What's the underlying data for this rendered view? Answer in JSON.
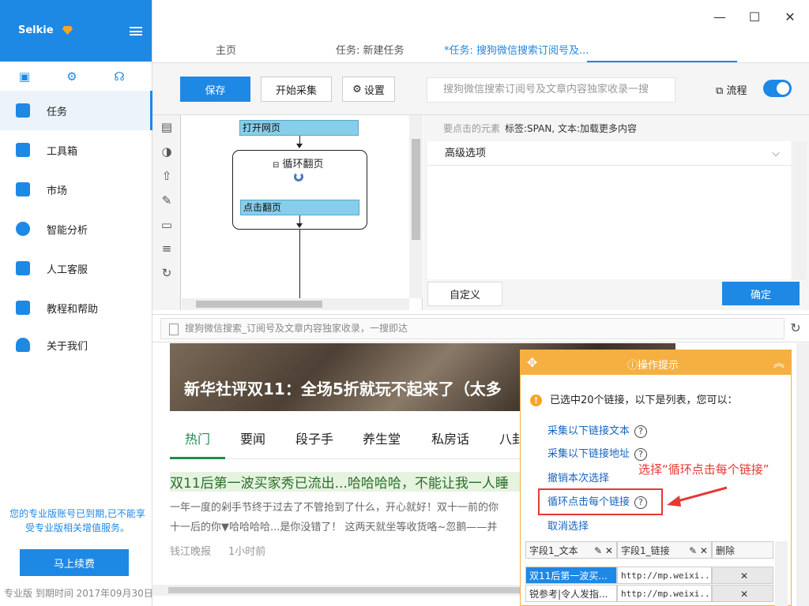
{
  "app": {
    "name": "Selkie"
  },
  "sidebar": {
    "items": [
      {
        "label": "任务"
      },
      {
        "label": "工具箱"
      },
      {
        "label": "市场"
      },
      {
        "label": "智能分析"
      },
      {
        "label": "人工客服"
      },
      {
        "label": "教程和帮助"
      },
      {
        "label": "关于我们"
      }
    ],
    "expire_notice": "您的专业版账号已到期,已不能享受专业版相关增值服务。",
    "renew_label": "马上续费",
    "version_line": "专业版  到期时间  2017年09月30日"
  },
  "tabs": [
    {
      "label": "主页"
    },
    {
      "label": "任务: 新建任务"
    },
    {
      "label": "*任务: 搜狗微信搜索订阅号及..."
    }
  ],
  "toolbar": {
    "save_label": "保存",
    "start_label": "开始采集",
    "settings_label": "设置",
    "task_name": "搜狗微信搜索订阅号及文章内容独家收录一搜",
    "flow_label": "流程"
  },
  "designer": {
    "step1": "打开网页",
    "loop_title": "循环翻页",
    "step2": "点击翻页"
  },
  "props": {
    "element_label": "要点击的元素",
    "element_value": "标签:SPAN, 文本:加载更多内容",
    "advanced_label": "高级选项",
    "custom_label": "自定义",
    "ok_label": "确定"
  },
  "url": {
    "value": "搜狗微信搜索_订阅号及文章内容独家收录，一搜即达"
  },
  "webpage": {
    "banner_title": "新华社评双11：全场5折就玩不起来了（太多",
    "tabs": [
      "热门",
      "要闻",
      "段子手",
      "养生堂",
      "私房话",
      "八卦"
    ],
    "headline": "双11后第一波买家秀已流出...哈哈哈哈，不能让我一人睡",
    "snippet1": "一年一度的剁手节终于过去了不管抢到了什么，开心就好！双十一前的你",
    "snippet2": "十一后的你▼哈哈哈哈...是你没错了！ 这两天就坐等收货咯~忽鹅——并",
    "source": "钱江晚报",
    "time": "1小时前"
  },
  "tips": {
    "title": "操作提示",
    "message": "已选中20个链接，以下是列表，您可以：",
    "options": [
      "采集以下链接文本",
      "采集以下链接地址",
      "撤销本次选择",
      "循环点击每个链接",
      "取消选择"
    ],
    "annotation": "选择“循环点击每个链接”",
    "table": {
      "headers": [
        "字段1_文本",
        "字段1_链接",
        "删除"
      ],
      "rows": [
        [
          "双11后第一波买...",
          "http://mp.weixi...",
          "✕"
        ],
        [
          "锐参考|令人发指...",
          "http://mp.weixi...",
          "✕"
        ]
      ]
    }
  }
}
